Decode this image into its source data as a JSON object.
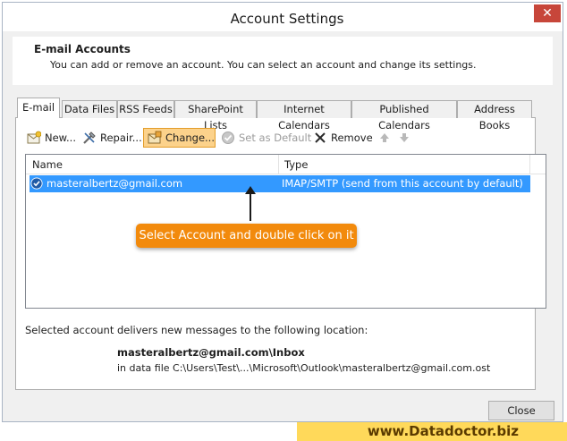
{
  "window": {
    "title": "Account Settings",
    "close_glyph": "✕"
  },
  "header": {
    "title": "E-mail Accounts",
    "subtitle": "You can add or remove an account. You can select an account and change its settings."
  },
  "tabs": [
    {
      "label": "E-mail",
      "active": true
    },
    {
      "label": "Data Files"
    },
    {
      "label": "RSS Feeds"
    },
    {
      "label": "SharePoint Lists"
    },
    {
      "label": "Internet Calendars"
    },
    {
      "label": "Published Calendars"
    },
    {
      "label": "Address Books"
    }
  ],
  "toolbar": {
    "new_label": "New...",
    "repair_label": "Repair...",
    "change_label": "Change...",
    "set_default_label": "Set as Default",
    "remove_label": "Remove"
  },
  "accounts_list": {
    "columns": [
      "Name",
      "Type"
    ],
    "rows": [
      {
        "name": "masteralbertz@gmail.com",
        "type": "IMAP/SMTP (send from this account by default)",
        "selected": true
      }
    ]
  },
  "callout": {
    "text": "Select Account and double click on it"
  },
  "delivery": {
    "label": "Selected account delivers new messages to the following location:",
    "folder": "masteralbertz@gmail.com\\Inbox",
    "file": "in data file C:\\Users\\Test\\...\\Microsoft\\Outlook\\masteralbertz@gmail.com.ost"
  },
  "footer": {
    "close_label": "Close"
  },
  "watermark": {
    "text": "www.Datadoctor.biz"
  },
  "colors": {
    "selection": "#3399ff",
    "callout": "#f28a0c",
    "highlight": "#fcd28b",
    "watermark_bg": "#ffd95a"
  }
}
